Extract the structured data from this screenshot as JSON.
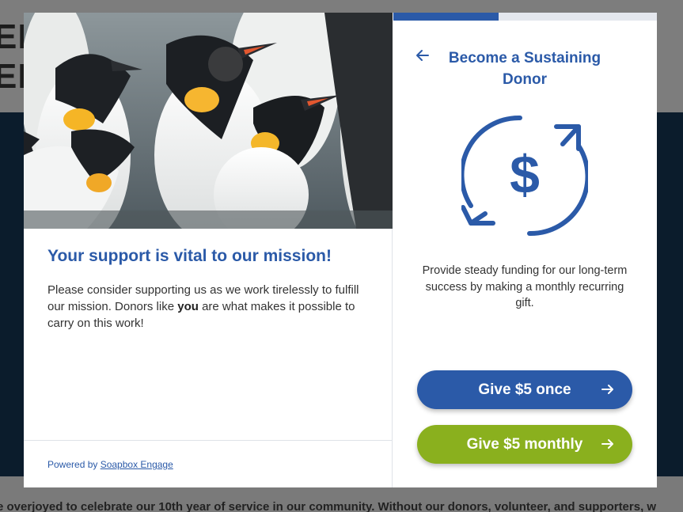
{
  "background": {
    "heading_line1": "EI",
    "heading_line2": "ER",
    "ticker_text": "e overjoyed to celebrate our 10th year of service in our community. Without our donors, volunteer, and supporters, w"
  },
  "modal": {
    "left": {
      "image_alt": "King penguins",
      "title": "Your support is vital to our mission!",
      "body_before": "Please consider supporting us as we work tirelessly to fulfill our mission. Donors like ",
      "body_bold": "you",
      "body_after": " are what makes it possible to carry on this work!",
      "powered_prefix": "Powered by ",
      "powered_link": "Soapbox Engage"
    },
    "right": {
      "progress": 0.4,
      "back_icon": "arrow-left-icon",
      "title": "Become a Sustaining Donor",
      "icon": "recurring-dollar-icon",
      "description": "Provide steady funding for our long-term success by making a monthly recurring gift.",
      "buttons": {
        "once_label": "Give $5 once",
        "monthly_label": "Give $5 monthly",
        "arrow_icon": "arrow-right-icon"
      }
    }
  },
  "colors": {
    "brand_blue": "#2b5aa8",
    "brand_green": "#8ab01e"
  }
}
